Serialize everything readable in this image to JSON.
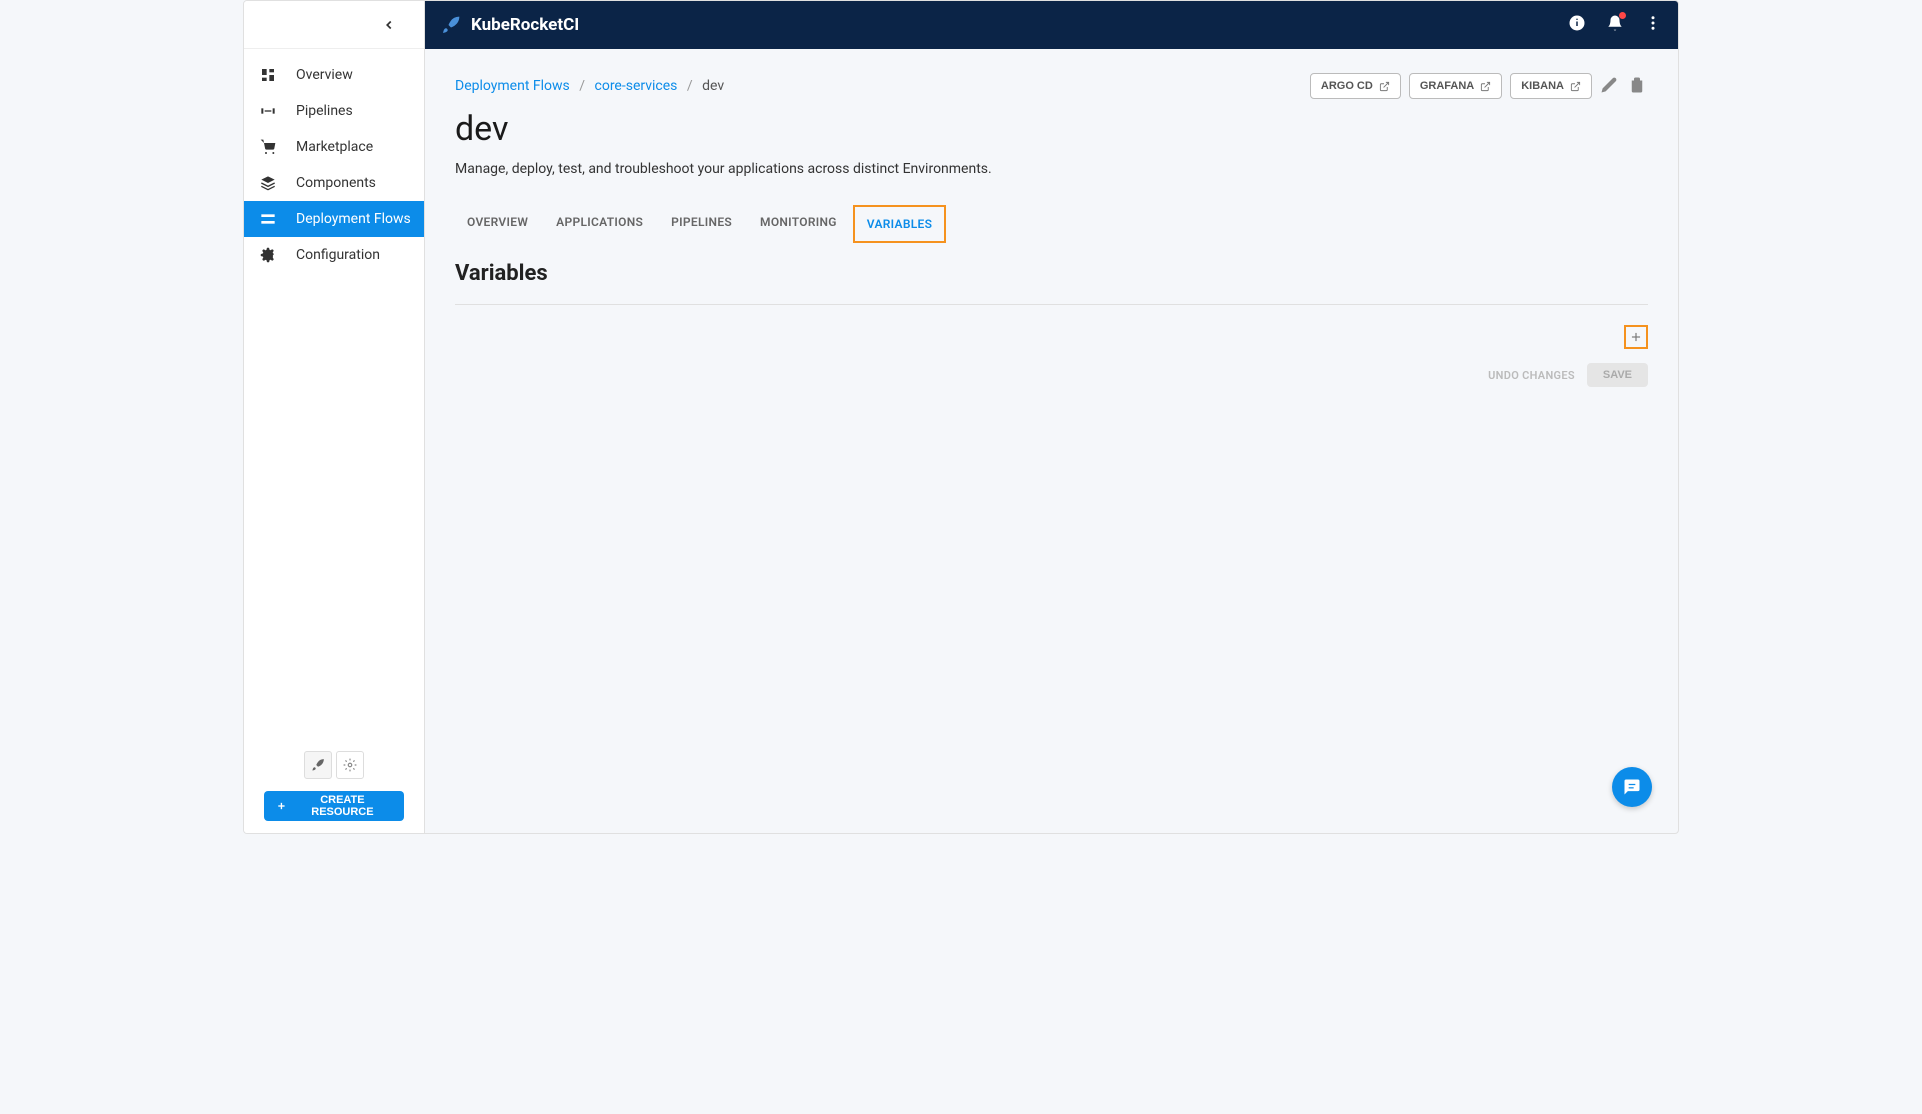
{
  "header": {
    "brand": "KubeRocketCI"
  },
  "sidebar": {
    "items": [
      {
        "label": "Overview"
      },
      {
        "label": "Pipelines"
      },
      {
        "label": "Marketplace"
      },
      {
        "label": "Components"
      },
      {
        "label": "Deployment Flows"
      },
      {
        "label": "Configuration"
      }
    ],
    "create_label": "CREATE RESOURCE"
  },
  "breadcrumb": {
    "item1": "Deployment Flows",
    "item2": "core-services",
    "current": "dev"
  },
  "external_links": {
    "argo": "ARGO CD",
    "grafana": "GRAFANA",
    "kibana": "KIBANA"
  },
  "page": {
    "title": "dev",
    "description": "Manage, deploy, test, and troubleshoot your applications across distinct Environments."
  },
  "tabs": {
    "overview": "OVERVIEW",
    "applications": "APPLICATIONS",
    "pipelines": "PIPELINES",
    "monitoring": "MONITORING",
    "variables": "VARIABLES"
  },
  "section": {
    "title": "Variables"
  },
  "buttons": {
    "undo": "UNDO CHANGES",
    "save": "SAVE"
  }
}
